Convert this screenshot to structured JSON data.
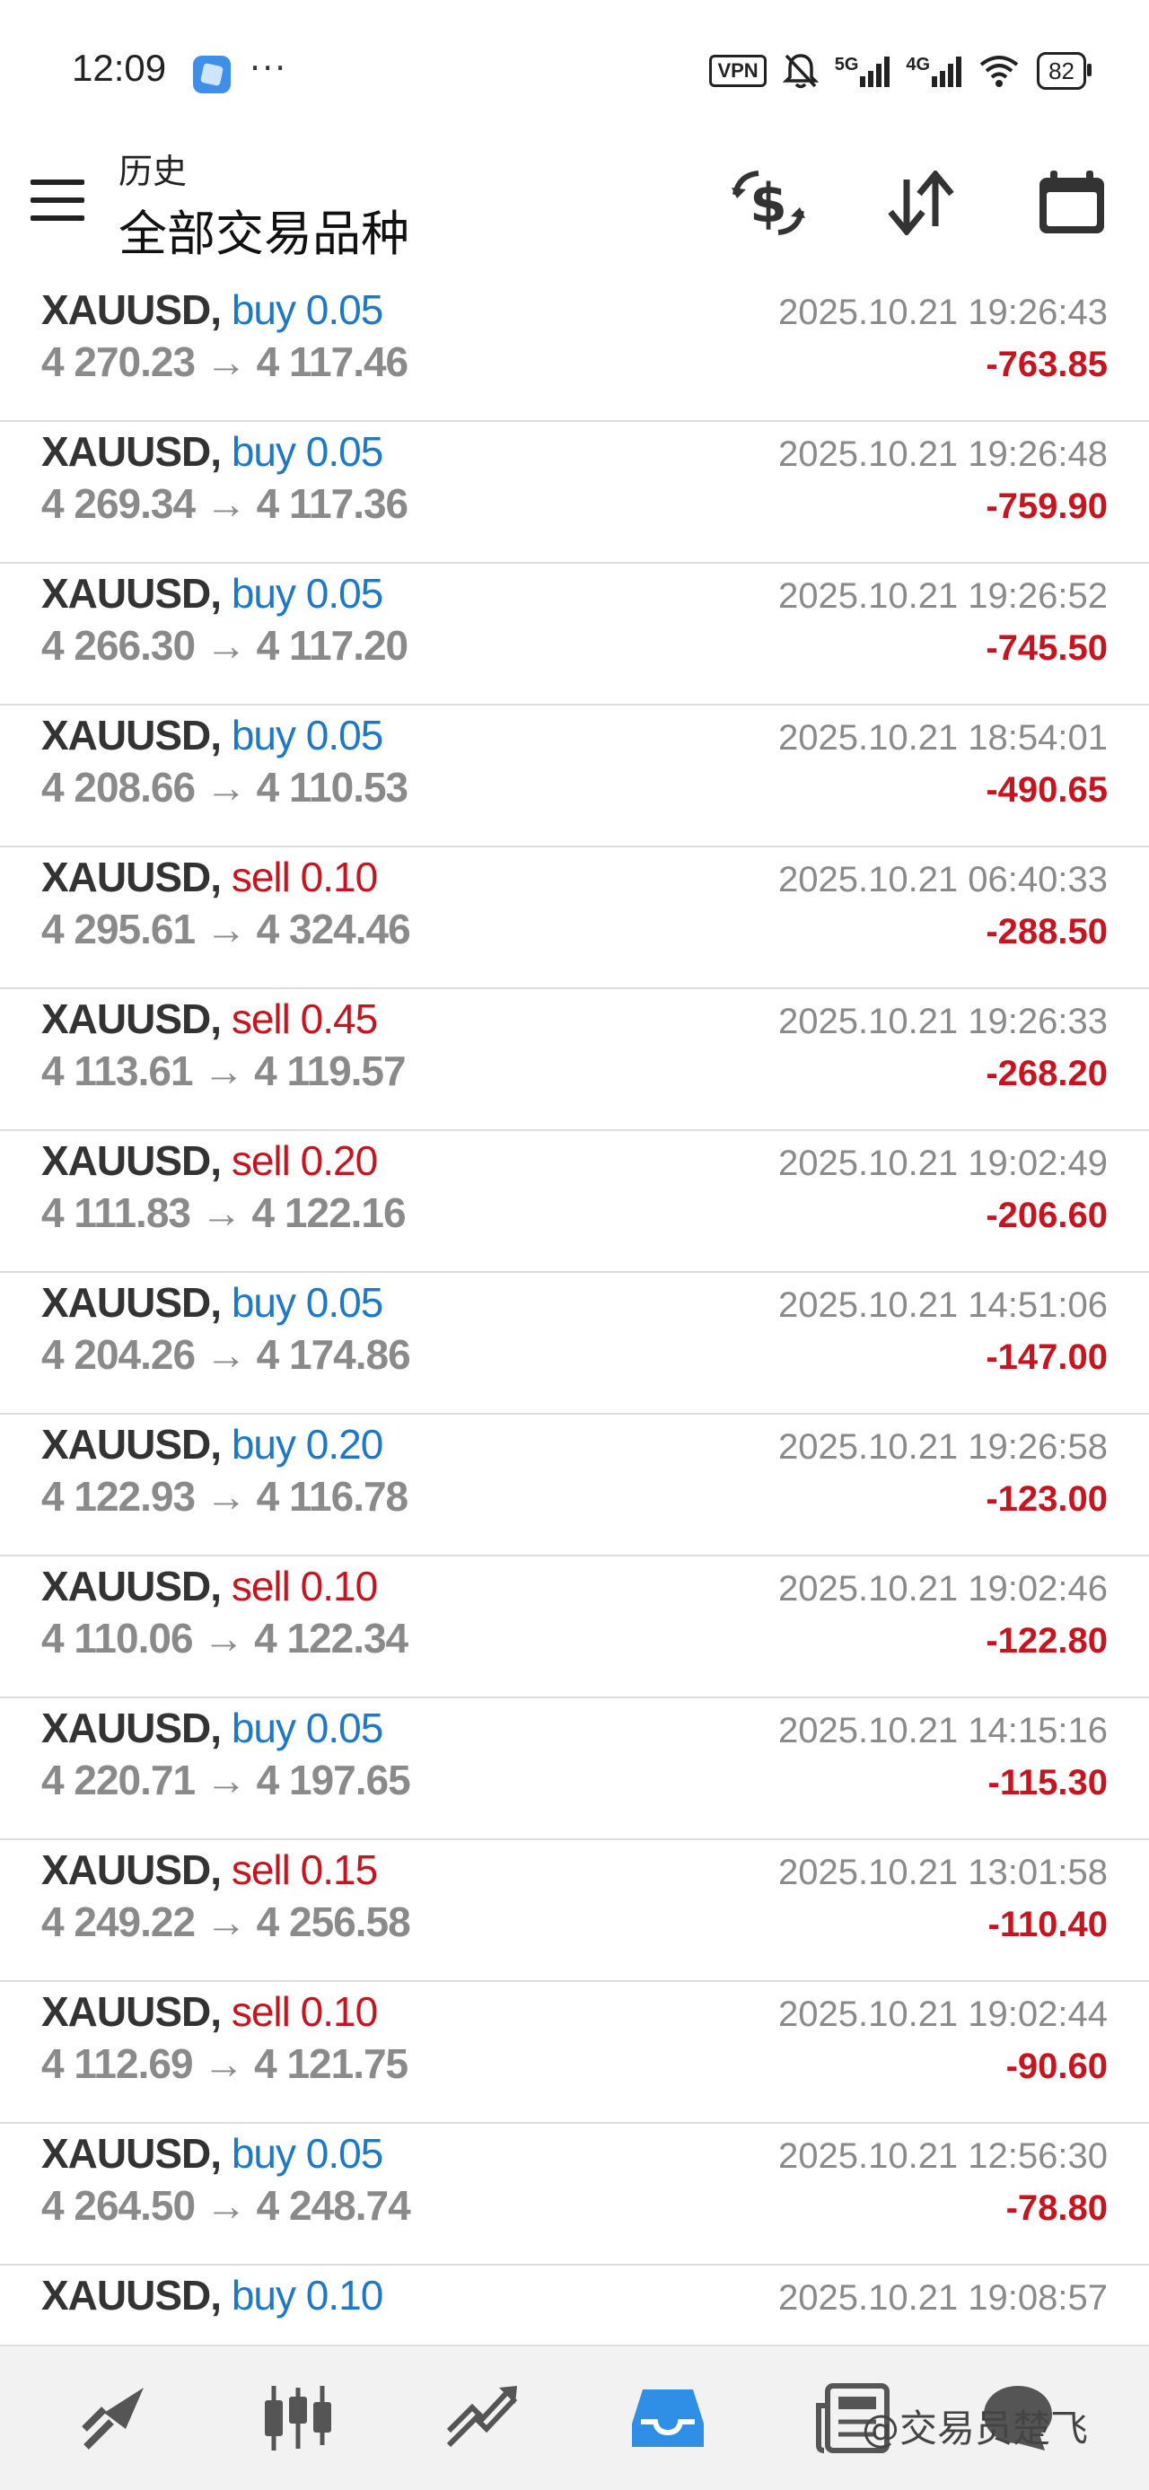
{
  "status_bar": {
    "time": "12:09",
    "more": "···",
    "vpn": "VPN",
    "net1": "5G",
    "net2": "4G",
    "battery": "82"
  },
  "header": {
    "subtitle": "历史",
    "title": "全部交易品种",
    "icons": [
      "currency-exchange-icon",
      "sort-icon",
      "calendar-icon"
    ]
  },
  "trades": [
    {
      "symbol": "XAUUSD,",
      "side": "buy",
      "volume": "0.05",
      "prices": "4 270.23 → 4 117.46",
      "time": "2025.10.21 19:26:43",
      "profit": "-763.85"
    },
    {
      "symbol": "XAUUSD,",
      "side": "buy",
      "volume": "0.05",
      "prices": "4 269.34 → 4 117.36",
      "time": "2025.10.21 19:26:48",
      "profit": "-759.90"
    },
    {
      "symbol": "XAUUSD,",
      "side": "buy",
      "volume": "0.05",
      "prices": "4 266.30 → 4 117.20",
      "time": "2025.10.21 19:26:52",
      "profit": "-745.50"
    },
    {
      "symbol": "XAUUSD,",
      "side": "buy",
      "volume": "0.05",
      "prices": "4 208.66 → 4 110.53",
      "time": "2025.10.21 18:54:01",
      "profit": "-490.65"
    },
    {
      "symbol": "XAUUSD,",
      "side": "sell",
      "volume": "0.10",
      "prices": "4 295.61 → 4 324.46",
      "time": "2025.10.21 06:40:33",
      "profit": "-288.50"
    },
    {
      "symbol": "XAUUSD,",
      "side": "sell",
      "volume": "0.45",
      "prices": "4 113.61 → 4 119.57",
      "time": "2025.10.21 19:26:33",
      "profit": "-268.20"
    },
    {
      "symbol": "XAUUSD,",
      "side": "sell",
      "volume": "0.20",
      "prices": "4 111.83 → 4 122.16",
      "time": "2025.10.21 19:02:49",
      "profit": "-206.60"
    },
    {
      "symbol": "XAUUSD,",
      "side": "buy",
      "volume": "0.05",
      "prices": "4 204.26 → 4 174.86",
      "time": "2025.10.21 14:51:06",
      "profit": "-147.00"
    },
    {
      "symbol": "XAUUSD,",
      "side": "buy",
      "volume": "0.20",
      "prices": "4 122.93 → 4 116.78",
      "time": "2025.10.21 19:26:58",
      "profit": "-123.00"
    },
    {
      "symbol": "XAUUSD,",
      "side": "sell",
      "volume": "0.10",
      "prices": "4 110.06 → 4 122.34",
      "time": "2025.10.21 19:02:46",
      "profit": "-122.80"
    },
    {
      "symbol": "XAUUSD,",
      "side": "buy",
      "volume": "0.05",
      "prices": "4 220.71 → 4 197.65",
      "time": "2025.10.21 14:15:16",
      "profit": "-115.30"
    },
    {
      "symbol": "XAUUSD,",
      "side": "sell",
      "volume": "0.15",
      "prices": "4 249.22 → 4 256.58",
      "time": "2025.10.21 13:01:58",
      "profit": "-110.40"
    },
    {
      "symbol": "XAUUSD,",
      "side": "sell",
      "volume": "0.10",
      "prices": "4 112.69 → 4 121.75",
      "time": "2025.10.21 19:02:44",
      "profit": "-90.60"
    },
    {
      "symbol": "XAUUSD,",
      "side": "buy",
      "volume": "0.05",
      "prices": "4 264.50 → 4 248.74",
      "time": "2025.10.21 12:56:30",
      "profit": "-78.80"
    },
    {
      "symbol": "XAUUSD,",
      "side": "buy",
      "volume": "0.10",
      "prices": "",
      "time": "2025.10.21 19:08:57",
      "profit": ""
    }
  ],
  "bottom_nav": {
    "items": [
      "quotes-icon",
      "chart-icon",
      "trade-icon",
      "history-icon",
      "news-icon",
      "chat-icon"
    ],
    "active": "history-icon",
    "watermark": "@交易员楚飞"
  },
  "colors": {
    "buy": "#1e78c8",
    "sell": "#c8141e",
    "profit_negative": "#c8141e",
    "nav_active": "#2f8fe6"
  }
}
